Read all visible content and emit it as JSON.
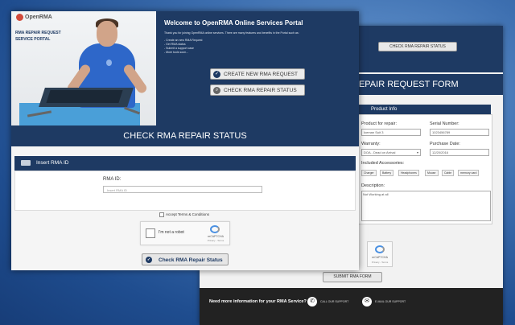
{
  "back_window": {
    "top_button_label": "CHECK RMA REPAIR STATUS",
    "form_title": "REPAIR REQUEST FORM",
    "product_info_title": "Product Info",
    "fields": {
      "product_label": "Product for repair:",
      "product_value": "Iceman Suit 3",
      "serial_label": "Serial Number:",
      "serial_value": "1023456789",
      "warranty_label": "Warranty:",
      "warranty_value": "DOA - Dead on Arrival",
      "purchase_label": "Purchase Date:",
      "purchase_value": "12/20/2016",
      "accessories_label": "Included Accessories:",
      "description_label": "Description:",
      "description_value": "Not Working at all"
    },
    "accessories": [
      "Charger",
      "Battery",
      "Headphones",
      "Mouse",
      "Cable",
      "memory card"
    ],
    "captcha_text": "reCAPTCHA",
    "captcha_privacy": "Privacy - Terms",
    "submit_label": "SUBMIT RMA FORM",
    "footer": {
      "question": "Need more information for your RMA Service?",
      "call_label": "CALL OUR SUPPORT",
      "email_label": "E-MAIL OUR SUPPORT"
    }
  },
  "front_window": {
    "logo_text": "OpenRMA",
    "portal_line1": "RMA REPAIR REQUEST",
    "portal_line2": "SERVICE PORTAL",
    "welcome_title": "Welcome to OpenRMA Online Services Portal",
    "intro_text": "Thank you for joining OpenRMA online services. There are many features and benefits in the Portal such as:",
    "bullets": [
      "- Create an new RMA Request",
      "- Get RMA status",
      "- Submit a support case",
      "- More tools soon..."
    ],
    "btn_create": "CREATE NEW RMA REQUEST",
    "btn_check": "CHECK RMA REPAIR STATUS",
    "section_title": "CHECK RMA REPAIR STATUS",
    "insert_title": "Insert RMA ID",
    "rma_label": "RMA ID:",
    "rma_placeholder": "Insert RMA ID",
    "terms_label": "Accept Terms & Conditions",
    "captcha_label": "I'm not a robot",
    "captcha_brand": "reCAPTCHA",
    "captcha_privacy": "Privacy - Terms",
    "check_button": "Check RMA Repair Status"
  },
  "colors": {
    "navy": "#1e3a63",
    "background_blue": "#3d6fb0"
  }
}
